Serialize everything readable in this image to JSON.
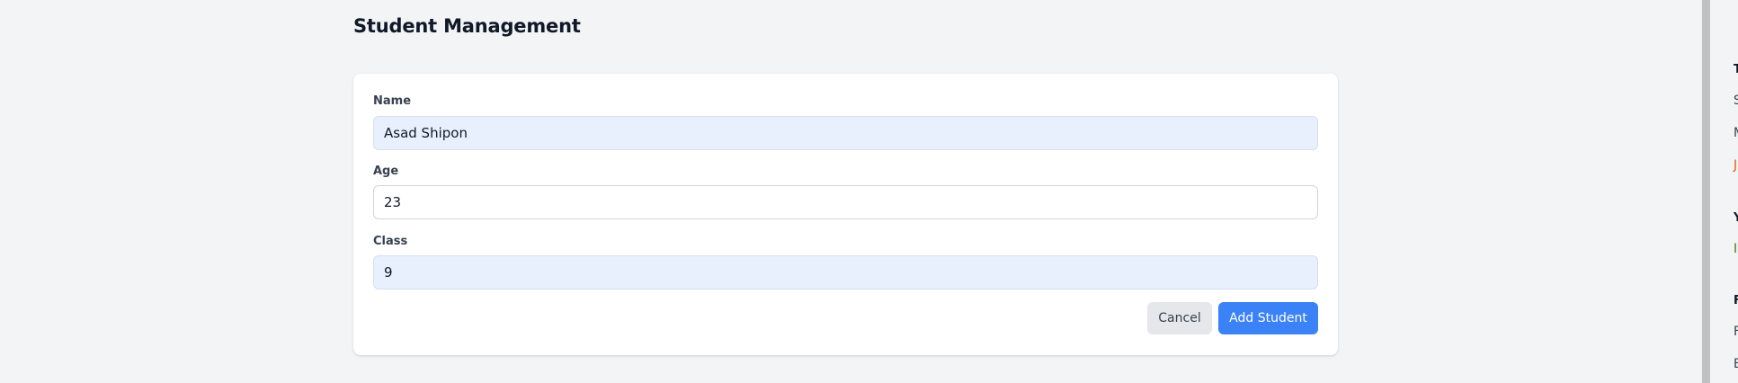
{
  "page": {
    "title": "Student Management"
  },
  "form": {
    "name": {
      "label": "Name",
      "value": "Asad Shipon"
    },
    "age": {
      "label": "Age",
      "value": "23"
    },
    "class": {
      "label": "Class",
      "value": "9"
    },
    "cancel_label": "Cancel",
    "submit_label": "Add Student"
  },
  "side_panel": {
    "lines": [
      "T",
      "S",
      "M",
      "J",
      "Y",
      "I",
      "F",
      "F",
      "E"
    ]
  },
  "colors": {
    "background": "#f3f4f6",
    "card": "#ffffff",
    "primary": "#3b82f6",
    "secondary_button": "#e5e7eb",
    "autofill": "#e8f0fe"
  }
}
